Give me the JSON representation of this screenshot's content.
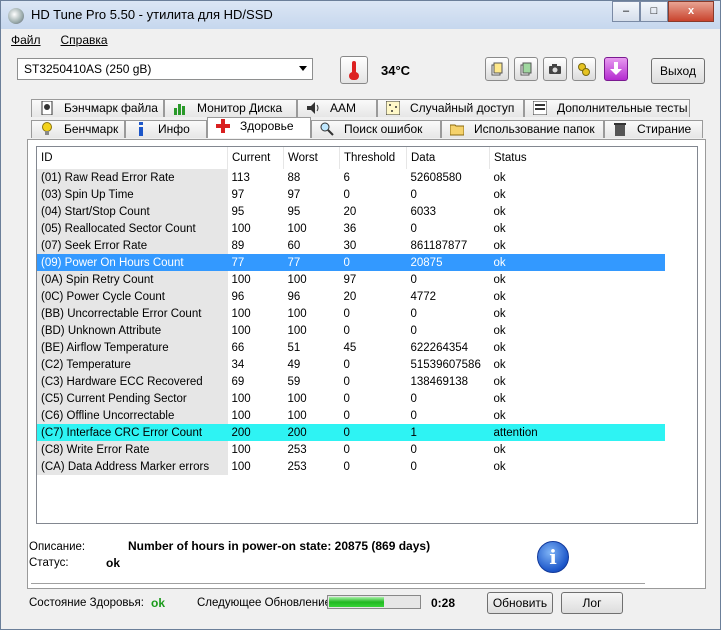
{
  "window": {
    "title": "HD Tune Pro 5.50 - утилита для HD/SSD",
    "controls": {
      "minimize": "–",
      "maximize": "□",
      "close": "x"
    }
  },
  "menu": [
    "Файл",
    "Справка"
  ],
  "toolbar": {
    "drive": "ST3250410AS (250 gB)",
    "temperature": "34°C",
    "exit_label": "Выход",
    "icons": [
      "copy-text-icon",
      "copy-info-icon",
      "screenshot-icon",
      "options-icon",
      "save-icon"
    ]
  },
  "tabs": {
    "row1": [
      "Бэнчмарк файла",
      "Монитор Диска",
      "AAM",
      "Случайный доступ",
      "Дополнительные тесты"
    ],
    "row2": [
      "Бенчмарк",
      "Инфо",
      "Здоровье",
      "Поиск ошибок",
      "Использование папок",
      "Стирание"
    ],
    "active": "Здоровье"
  },
  "health_table": {
    "columns": [
      "ID",
      "Current",
      "Worst",
      "Threshold",
      "Data",
      "Status"
    ],
    "rows": [
      {
        "id": "(01) Raw Read Error Rate",
        "current": "113",
        "worst": "88",
        "threshold": "6",
        "data": "52608580",
        "status": "ok"
      },
      {
        "id": "(03) Spin Up Time",
        "current": "97",
        "worst": "97",
        "threshold": "0",
        "data": "0",
        "status": "ok"
      },
      {
        "id": "(04) Start/Stop Count",
        "current": "95",
        "worst": "95",
        "threshold": "20",
        "data": "6033",
        "status": "ok"
      },
      {
        "id": "(05) Reallocated Sector Count",
        "current": "100",
        "worst": "100",
        "threshold": "36",
        "data": "0",
        "status": "ok"
      },
      {
        "id": "(07) Seek Error Rate",
        "current": "89",
        "worst": "60",
        "threshold": "30",
        "data": "861187877",
        "status": "ok"
      },
      {
        "id": "(09) Power On Hours Count",
        "current": "77",
        "worst": "77",
        "threshold": "0",
        "data": "20875",
        "status": "ok"
      },
      {
        "id": "(0A) Spin Retry Count",
        "current": "100",
        "worst": "100",
        "threshold": "97",
        "data": "0",
        "status": "ok"
      },
      {
        "id": "(0C) Power Cycle Count",
        "current": "96",
        "worst": "96",
        "threshold": "20",
        "data": "4772",
        "status": "ok"
      },
      {
        "id": "(BB) Uncorrectable Error Count",
        "current": "100",
        "worst": "100",
        "threshold": "0",
        "data": "0",
        "status": "ok"
      },
      {
        "id": "(BD) Unknown Attribute",
        "current": "100",
        "worst": "100",
        "threshold": "0",
        "data": "0",
        "status": "ok"
      },
      {
        "id": "(BE) Airflow Temperature",
        "current": "66",
        "worst": "51",
        "threshold": "45",
        "data": "622264354",
        "status": "ok"
      },
      {
        "id": "(C2) Temperature",
        "current": "34",
        "worst": "49",
        "threshold": "0",
        "data": "51539607586",
        "status": "ok"
      },
      {
        "id": "(C3) Hardware ECC Recovered",
        "current": "69",
        "worst": "59",
        "threshold": "0",
        "data": "138469138",
        "status": "ok"
      },
      {
        "id": "(C5) Current Pending Sector",
        "current": "100",
        "worst": "100",
        "threshold": "0",
        "data": "0",
        "status": "ok"
      },
      {
        "id": "(C6) Offline Uncorrectable",
        "current": "100",
        "worst": "100",
        "threshold": "0",
        "data": "0",
        "status": "ok"
      },
      {
        "id": "(C7) Interface CRC Error Count",
        "current": "200",
        "worst": "200",
        "threshold": "0",
        "data": "1",
        "status": "attention"
      },
      {
        "id": "(C8) Write Error Rate",
        "current": "100",
        "worst": "253",
        "threshold": "0",
        "data": "0",
        "status": "ok"
      },
      {
        "id": "(CA) Data Address Marker errors",
        "current": "100",
        "worst": "253",
        "threshold": "0",
        "data": "0",
        "status": "ok"
      }
    ],
    "selected_row": 5,
    "warning_row": 15
  },
  "details": {
    "description_label": "Описание:",
    "description_value": "Number of hours in power-on state: 20875 (869 days)",
    "status_label": "Статус:",
    "status_value": "ok"
  },
  "footer": {
    "health_label": "Состояние Здоровья:",
    "health_value": "ok",
    "next_update_label": "Следующее Обновление:",
    "next_update_progress": 0.6,
    "timer": "0:28",
    "update_button": "Обновить",
    "log_button": "Лог"
  },
  "colors": {
    "selected_row": "#3399ff",
    "warning_row": "#2ef3f3",
    "ok_green": "#1a9a1a"
  }
}
